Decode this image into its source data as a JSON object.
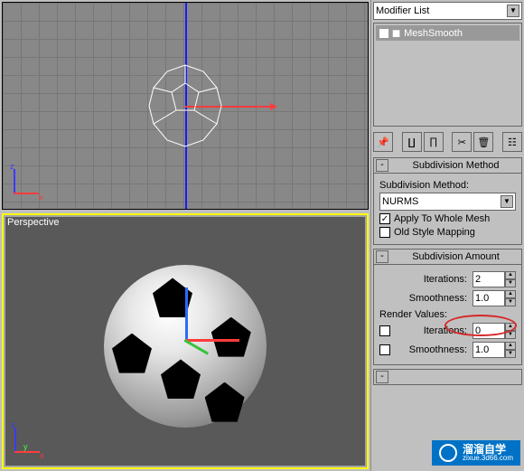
{
  "modifier_dropdown": {
    "label": "Modifier List"
  },
  "stack": {
    "items": [
      {
        "label": "MeshSmooth"
      }
    ]
  },
  "viewports": {
    "bottom_label": "Perspective",
    "axes": {
      "x": "x",
      "y": "y",
      "z": "z"
    }
  },
  "rollup_method": {
    "title": "Subdivision Method",
    "label": "Subdivision Method:",
    "value": "NURMS",
    "apply_whole": "Apply To Whole Mesh",
    "old_style": "Old Style Mapping"
  },
  "rollup_amount": {
    "title": "Subdivision Amount",
    "iterations_label": "Iterations:",
    "iterations_value": "2",
    "smoothness_label": "Smoothness:",
    "smoothness_value": "1.0",
    "render_values": "Render Values:",
    "r_iterations_value": "0",
    "r_smoothness_value": "1.0"
  },
  "watermark": {
    "brand": "溜溜自学",
    "url": "zixue.3d66.com"
  }
}
